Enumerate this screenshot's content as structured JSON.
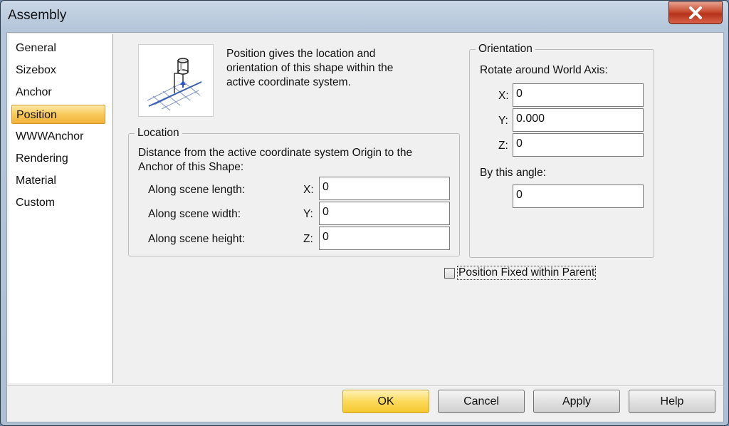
{
  "window": {
    "title": "Assembly",
    "close_icon": "close-x"
  },
  "nav": {
    "items": [
      {
        "label": "General"
      },
      {
        "label": "Sizebox"
      },
      {
        "label": "Anchor"
      },
      {
        "label": "Position",
        "selected": true
      },
      {
        "label": "WWWAnchor"
      },
      {
        "label": "Rendering"
      },
      {
        "label": "Material"
      },
      {
        "label": "Custom"
      }
    ]
  },
  "intro": {
    "icon": "position-shape-icon",
    "line1": "Position gives the location and",
    "line2": "orientation of this shape within the",
    "line3": "active coordinate system."
  },
  "location": {
    "legend": "Location",
    "desc_line1": "Distance from the active coordinate system Origin to the",
    "desc_line2": "Anchor of this Shape:",
    "rows": [
      {
        "label": "Along scene length:",
        "axis": "X:",
        "value": "0"
      },
      {
        "label": "Along scene width:",
        "axis": "Y:",
        "value": "0"
      },
      {
        "label": "Along scene height:",
        "axis": "Z:",
        "value": "0"
      }
    ]
  },
  "orientation": {
    "legend": "Orientation",
    "rotate_label": "Rotate around World Axis:",
    "rows": [
      {
        "axis": "X:",
        "value": "0"
      },
      {
        "axis": "Y:",
        "value": "0.000"
      },
      {
        "axis": "Z:",
        "value": "0"
      }
    ],
    "angle_label": "By this angle:",
    "angle_value": "0"
  },
  "fixed_checkbox": {
    "label": "Position Fixed within Parent",
    "checked": false
  },
  "buttons": {
    "ok": "OK",
    "cancel": "Cancel",
    "apply": "Apply",
    "help": "Help"
  },
  "colors": {
    "accent": "#f8c95a",
    "close": "#c84b2f"
  }
}
